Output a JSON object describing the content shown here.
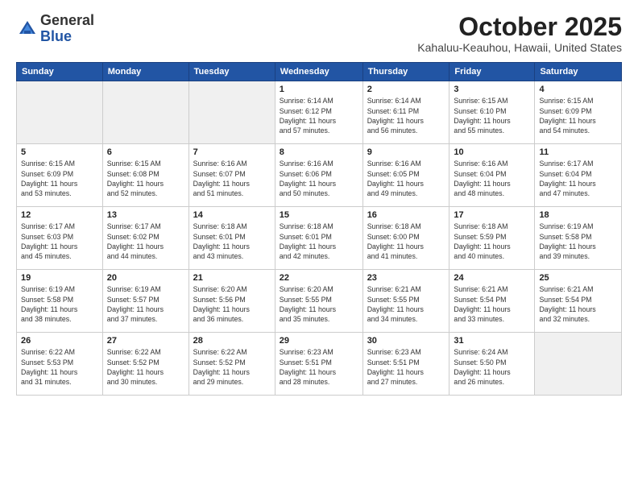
{
  "header": {
    "logo_general": "General",
    "logo_blue": "Blue",
    "month_title": "October 2025",
    "location": "Kahaluu-Keauhou, Hawaii, United States"
  },
  "days_of_week": [
    "Sunday",
    "Monday",
    "Tuesday",
    "Wednesday",
    "Thursday",
    "Friday",
    "Saturday"
  ],
  "weeks": [
    [
      {
        "num": "",
        "info": ""
      },
      {
        "num": "",
        "info": ""
      },
      {
        "num": "",
        "info": ""
      },
      {
        "num": "1",
        "info": "Sunrise: 6:14 AM\nSunset: 6:12 PM\nDaylight: 11 hours\nand 57 minutes."
      },
      {
        "num": "2",
        "info": "Sunrise: 6:14 AM\nSunset: 6:11 PM\nDaylight: 11 hours\nand 56 minutes."
      },
      {
        "num": "3",
        "info": "Sunrise: 6:15 AM\nSunset: 6:10 PM\nDaylight: 11 hours\nand 55 minutes."
      },
      {
        "num": "4",
        "info": "Sunrise: 6:15 AM\nSunset: 6:09 PM\nDaylight: 11 hours\nand 54 minutes."
      }
    ],
    [
      {
        "num": "5",
        "info": "Sunrise: 6:15 AM\nSunset: 6:09 PM\nDaylight: 11 hours\nand 53 minutes."
      },
      {
        "num": "6",
        "info": "Sunrise: 6:15 AM\nSunset: 6:08 PM\nDaylight: 11 hours\nand 52 minutes."
      },
      {
        "num": "7",
        "info": "Sunrise: 6:16 AM\nSunset: 6:07 PM\nDaylight: 11 hours\nand 51 minutes."
      },
      {
        "num": "8",
        "info": "Sunrise: 6:16 AM\nSunset: 6:06 PM\nDaylight: 11 hours\nand 50 minutes."
      },
      {
        "num": "9",
        "info": "Sunrise: 6:16 AM\nSunset: 6:05 PM\nDaylight: 11 hours\nand 49 minutes."
      },
      {
        "num": "10",
        "info": "Sunrise: 6:16 AM\nSunset: 6:04 PM\nDaylight: 11 hours\nand 48 minutes."
      },
      {
        "num": "11",
        "info": "Sunrise: 6:17 AM\nSunset: 6:04 PM\nDaylight: 11 hours\nand 47 minutes."
      }
    ],
    [
      {
        "num": "12",
        "info": "Sunrise: 6:17 AM\nSunset: 6:03 PM\nDaylight: 11 hours\nand 45 minutes."
      },
      {
        "num": "13",
        "info": "Sunrise: 6:17 AM\nSunset: 6:02 PM\nDaylight: 11 hours\nand 44 minutes."
      },
      {
        "num": "14",
        "info": "Sunrise: 6:18 AM\nSunset: 6:01 PM\nDaylight: 11 hours\nand 43 minutes."
      },
      {
        "num": "15",
        "info": "Sunrise: 6:18 AM\nSunset: 6:01 PM\nDaylight: 11 hours\nand 42 minutes."
      },
      {
        "num": "16",
        "info": "Sunrise: 6:18 AM\nSunset: 6:00 PM\nDaylight: 11 hours\nand 41 minutes."
      },
      {
        "num": "17",
        "info": "Sunrise: 6:18 AM\nSunset: 5:59 PM\nDaylight: 11 hours\nand 40 minutes."
      },
      {
        "num": "18",
        "info": "Sunrise: 6:19 AM\nSunset: 5:58 PM\nDaylight: 11 hours\nand 39 minutes."
      }
    ],
    [
      {
        "num": "19",
        "info": "Sunrise: 6:19 AM\nSunset: 5:58 PM\nDaylight: 11 hours\nand 38 minutes."
      },
      {
        "num": "20",
        "info": "Sunrise: 6:19 AM\nSunset: 5:57 PM\nDaylight: 11 hours\nand 37 minutes."
      },
      {
        "num": "21",
        "info": "Sunrise: 6:20 AM\nSunset: 5:56 PM\nDaylight: 11 hours\nand 36 minutes."
      },
      {
        "num": "22",
        "info": "Sunrise: 6:20 AM\nSunset: 5:55 PM\nDaylight: 11 hours\nand 35 minutes."
      },
      {
        "num": "23",
        "info": "Sunrise: 6:21 AM\nSunset: 5:55 PM\nDaylight: 11 hours\nand 34 minutes."
      },
      {
        "num": "24",
        "info": "Sunrise: 6:21 AM\nSunset: 5:54 PM\nDaylight: 11 hours\nand 33 minutes."
      },
      {
        "num": "25",
        "info": "Sunrise: 6:21 AM\nSunset: 5:54 PM\nDaylight: 11 hours\nand 32 minutes."
      }
    ],
    [
      {
        "num": "26",
        "info": "Sunrise: 6:22 AM\nSunset: 5:53 PM\nDaylight: 11 hours\nand 31 minutes."
      },
      {
        "num": "27",
        "info": "Sunrise: 6:22 AM\nSunset: 5:52 PM\nDaylight: 11 hours\nand 30 minutes."
      },
      {
        "num": "28",
        "info": "Sunrise: 6:22 AM\nSunset: 5:52 PM\nDaylight: 11 hours\nand 29 minutes."
      },
      {
        "num": "29",
        "info": "Sunrise: 6:23 AM\nSunset: 5:51 PM\nDaylight: 11 hours\nand 28 minutes."
      },
      {
        "num": "30",
        "info": "Sunrise: 6:23 AM\nSunset: 5:51 PM\nDaylight: 11 hours\nand 27 minutes."
      },
      {
        "num": "31",
        "info": "Sunrise: 6:24 AM\nSunset: 5:50 PM\nDaylight: 11 hours\nand 26 minutes."
      },
      {
        "num": "",
        "info": ""
      }
    ]
  ]
}
